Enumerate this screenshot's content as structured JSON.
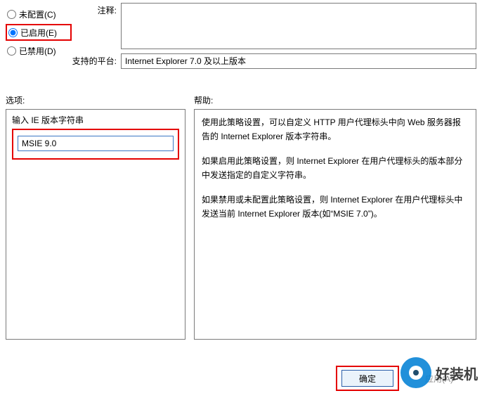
{
  "radios": {
    "not_configured": "未配置(C)",
    "enabled": "已启用(E)",
    "disabled": "已禁用(D)",
    "selected": "enabled"
  },
  "labels": {
    "comment": "注释:",
    "platform": "支持的平台:",
    "options": "选项:",
    "help": "帮助:",
    "input_caption": "输入 IE 版本字符串"
  },
  "values": {
    "comment": "",
    "platform": "Internet Explorer 7.0 及以上版本",
    "version_string": "MSIE 9.0"
  },
  "help": {
    "p1": "使用此策略设置，可以自定义 HTTP 用户代理标头中向 Web 服务器报告的 Internet Explorer 版本字符串。",
    "p2": "如果启用此策略设置，则 Internet Explorer 在用户代理标头的版本部分中发送指定的自定义字符串。",
    "p3": "如果禁用或未配置此策略设置，则 Internet Explorer 在用户代理标头中发送当前 Internet Explorer 版本(如“MSIE 7.0”)。"
  },
  "buttons": {
    "ok": "确定",
    "apply": "应用(A)"
  },
  "watermark": "好装机"
}
